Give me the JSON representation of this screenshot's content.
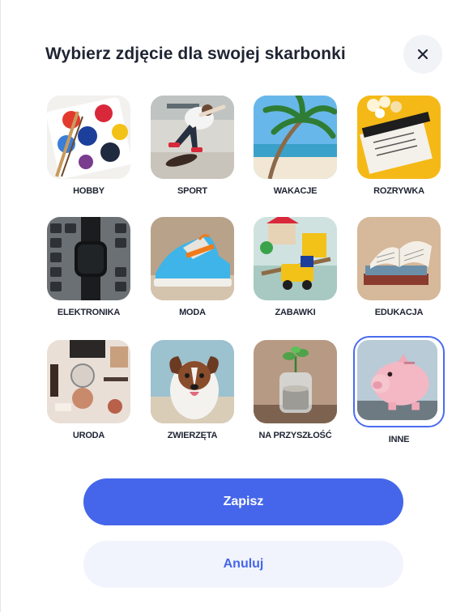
{
  "dialog": {
    "title": "Wybierz zdjęcie dla swojej skarbonki",
    "close_icon": "close-icon"
  },
  "categories": [
    {
      "label": "HOBBY",
      "image": "paint-palette",
      "selected": false
    },
    {
      "label": "SPORT",
      "image": "skateboarder",
      "selected": false
    },
    {
      "label": "WAKACJE",
      "image": "palm-beach",
      "selected": false
    },
    {
      "label": "ROZRYWKA",
      "image": "clapperboard-popcorn",
      "selected": false
    },
    {
      "label": "ELEKTRONIKA",
      "image": "smartwatch-keyboard",
      "selected": false
    },
    {
      "label": "MODA",
      "image": "sneaker",
      "selected": false
    },
    {
      "label": "ZABAWKI",
      "image": "toy-train",
      "selected": false
    },
    {
      "label": "EDUKACJA",
      "image": "open-book",
      "selected": false
    },
    {
      "label": "URODA",
      "image": "cosmetics",
      "selected": false
    },
    {
      "label": "ZWIERZĘTA",
      "image": "dog",
      "selected": false
    },
    {
      "label": "NA PRZYSZŁOŚĆ",
      "image": "coin-jar-plant",
      "selected": false
    },
    {
      "label": "INNE",
      "image": "piggy-bank",
      "selected": true
    }
  ],
  "actions": {
    "save_label": "Zapisz",
    "cancel_label": "Anuluj"
  },
  "colors": {
    "primary": "#4566ea",
    "secondary_bg": "#f2f4fd",
    "text": "#1f2433"
  }
}
